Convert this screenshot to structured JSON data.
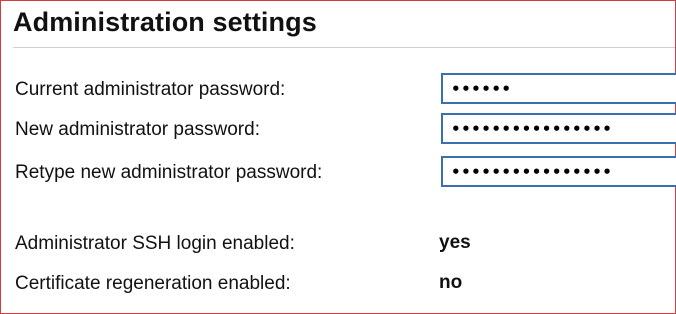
{
  "page": {
    "title": "Administration settings"
  },
  "form": {
    "current_password": {
      "label": "Current administrator password:",
      "value": "••••••"
    },
    "new_password": {
      "label": "New administrator password:",
      "value": "••••••••••••••••"
    },
    "retype_password": {
      "label": "Retype new administrator password:",
      "value": "••••••••••••••••"
    }
  },
  "status": {
    "ssh_login": {
      "label": "Administrator SSH login enabled:",
      "value": "yes"
    },
    "cert_regen": {
      "label": "Certificate regeneration enabled:",
      "value": "no"
    }
  },
  "colors": {
    "frame_border": "#d23c3c",
    "field_border": "#3a70b0"
  }
}
